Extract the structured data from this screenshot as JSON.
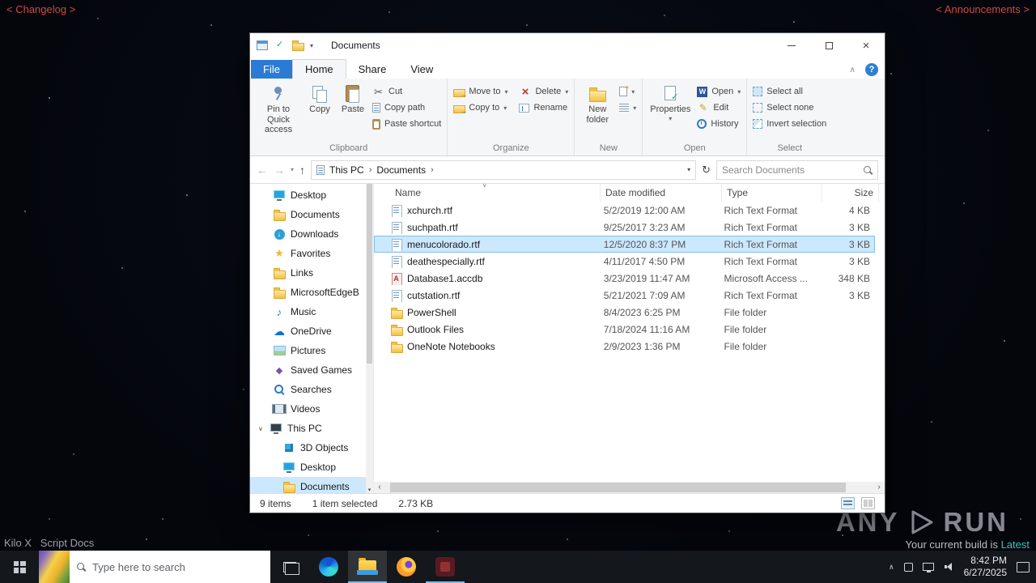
{
  "desktop": {
    "changelog": "< Changelog >",
    "announcements": "< Announcements >",
    "bottom_left": "Kilo X   Script Docs",
    "watermark": {
      "brand_left": "ANY",
      "brand_right": "RUN",
      "build_prefix": "Your current build is",
      "build_status": "Latest"
    }
  },
  "explorer": {
    "title": "Documents",
    "menu": {
      "file": "File",
      "home": "Home",
      "share": "Share",
      "view": "View"
    },
    "ribbon": {
      "clipboard": {
        "label": "Clipboard",
        "pin": "Pin to Quick access",
        "copy": "Copy",
        "paste": "Paste",
        "cut": "Cut",
        "copy_path": "Copy path",
        "paste_shortcut": "Paste shortcut"
      },
      "organize": {
        "label": "Organize",
        "move_to": "Move to",
        "copy_to": "Copy to",
        "del": "Delete",
        "rename": "Rename"
      },
      "new_group": {
        "label": "New",
        "new_folder": "New folder"
      },
      "open_group": {
        "label": "Open",
        "properties": "Properties",
        "open": "Open",
        "edit": "Edit",
        "history": "History"
      },
      "select_group": {
        "label": "Select",
        "select_all": "Select all",
        "select_none": "Select none",
        "invert": "Invert selection"
      }
    },
    "address": {
      "root": "This PC",
      "current": "Documents",
      "search_placeholder": "Search Documents"
    },
    "sidebar": {
      "items": [
        {
          "label": "Desktop"
        },
        {
          "label": "Documents"
        },
        {
          "label": "Downloads"
        },
        {
          "label": "Favorites"
        },
        {
          "label": "Links"
        },
        {
          "label": "MicrosoftEdgeB"
        },
        {
          "label": "Music"
        },
        {
          "label": "OneDrive"
        },
        {
          "label": "Pictures"
        },
        {
          "label": "Saved Games"
        },
        {
          "label": "Searches"
        },
        {
          "label": "Videos"
        },
        {
          "label": "This PC"
        },
        {
          "label": "3D Objects"
        },
        {
          "label": "Desktop"
        },
        {
          "label": "Documents"
        }
      ]
    },
    "columns": {
      "name": "Name",
      "date": "Date modified",
      "type": "Type",
      "size": "Size"
    },
    "files": [
      {
        "name": "xchurch.rtf",
        "date": "5/2/2019 12:00 AM",
        "type": "Rich Text Format",
        "size": "4 KB"
      },
      {
        "name": "suchpath.rtf",
        "date": "9/25/2017 3:23 AM",
        "type": "Rich Text Format",
        "size": "3 KB"
      },
      {
        "name": "menucolorado.rtf",
        "date": "12/5/2020 8:37 PM",
        "type": "Rich Text Format",
        "size": "3 KB"
      },
      {
        "name": "deathespecially.rtf",
        "date": "4/11/2017 4:50 PM",
        "type": "Rich Text Format",
        "size": "3 KB"
      },
      {
        "name": "Database1.accdb",
        "date": "3/23/2019 11:47 AM",
        "type": "Microsoft Access ...",
        "size": "348 KB"
      },
      {
        "name": "cutstation.rtf",
        "date": "5/21/2021 7:09 AM",
        "type": "Rich Text Format",
        "size": "3 KB"
      },
      {
        "name": "PowerShell",
        "date": "8/4/2023 6:25 PM",
        "type": "File folder",
        "size": ""
      },
      {
        "name": "Outlook Files",
        "date": "7/18/2024 11:16 AM",
        "type": "File folder",
        "size": ""
      },
      {
        "name": "OneNote Notebooks",
        "date": "2/9/2023 1:36 PM",
        "type": "File folder",
        "size": ""
      }
    ],
    "status": {
      "count": "9 items",
      "selected": "1 item selected",
      "size": "2.73 KB"
    }
  },
  "taskbar": {
    "search_placeholder": "Type here to search",
    "time": "8:42 PM",
    "date": "6/27/2025"
  }
}
